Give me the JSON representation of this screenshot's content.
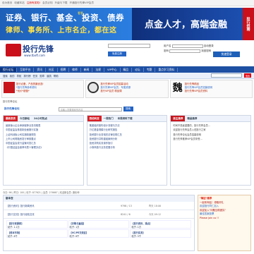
{
  "topbar": {
    "items": [
      "设为首页",
      "收藏本站",
      "注册有奖啦!",
      "会员必知",
      "升级与下载",
      "开通投行先锋VIP会员"
    ]
  },
  "banner": {
    "line1": "证券、银行、基金、投资、债券",
    "line2": "律师、事务所、上市名企，都在这",
    "tagline": "看看",
    "right": "点金人才，高端金融",
    "side": "投行招聘"
  },
  "logo": {
    "name": "投行先锋",
    "url": "www.tbxft.com"
  },
  "header": {
    "search_placeholder": "",
    "register": "免费注册",
    "username_label": "用户名",
    "password_label": "密码",
    "remember": "自动登录",
    "forgot": "找回密码",
    "login_button": "快速登录",
    "login_title": "快速登录"
  },
  "nav": {
    "items": [
      "投行论坛",
      "互助平台",
      "资讯",
      "社区",
      "招聘",
      "律师",
      "新闻",
      "法规",
      "VIP中心",
      "精品",
      "论坛",
      "专题",
      "重点学习资料"
    ]
  },
  "subnav": {
    "items": [
      "搜索",
      "我的",
      "导航",
      "排行榜",
      "任务",
      "勋章",
      "道具",
      "帮助",
      "认证",
      "分享",
      "推荐",
      "收藏"
    ],
    "search_btn": "搜索"
  },
  "ads": [
    {
      "l1": "投行必备，产品的最优选!",
      "l2": "*投行先锋参考资料",
      "l3": "*优价*超值*"
    },
    {
      "l1": "投行先锋VIP会员招募活动",
      "l2": "投行先锋VIP会员，专属资源",
      "l3": "投行VIP会员 精品课"
    },
    {
      "l1": "投行先锋精品",
      "l2": "投行先锋VIP会员招募说明",
      "l3": "投行先锋VIP会员资料"
    }
  ],
  "crumb": "投行先锋论坛",
  "midbar": {
    "brand": "投行先锋论坛",
    "search_placeholder": "请输入您要搜索的内容",
    "search_btn": "搜索"
  },
  "panels": [
    {
      "tabs": [
        "最新发表",
        "今日新帖",
        "24小时热点"
      ],
      "items": [
        "最新版以企业承销保荐业务流程表",
        "中国证监会核准制全面推行实施",
        "上证科创板公司实施制度规范",
        "上市公司再融资发行审核要点",
        "中国证监会发行监管问答汇总",
        "《中国证监会保荐代表人管理办法》"
      ]
    },
    {
      "tabs": [
        "西伯利亚",
        "一周热门",
        "本周资料下载"
      ],
      "items": [
        "集团组织架构设计流程与方法",
        "万亿基金规模行业研究报告",
        "投资银行业务相关法律法规汇总",
        "投资银行并购重组案例分析",
        "投资并购实务操作指引",
        "小券商投行业务发展分析"
      ]
    },
    {
      "tabs": [
        "版主推荐",
        "精品推荐"
      ],
      "items": [
        "时间不是最重要的，投行先锋会员...",
        "欢迎投行先锋会员入驻投行之家",
        "投行先锋论坛会员招募说明",
        "投行先锋推荐VIP会员享受..."
      ]
    }
  ],
  "stats": {
    "today": "今日: 96",
    "yesterday": "昨日: 100",
    "posts": "帖子: 877621",
    "members": "会员: 276667",
    "newest": "欢迎新会员: 唐化坤"
  },
  "forum": {
    "title": "版本去",
    "sections": [
      {
        "name": "【投行资讯】投行新闻资讯",
        "count": "9798 / 13",
        "last": "昨天 18:06"
      },
      {
        "name": "【投行交流】投行经验交流",
        "count": "8241 / 6",
        "last": "今天 09:12"
      }
    ],
    "cells": [
      {
        "title": "【投行资源库】",
        "posts": "帖子: 1.1万"
      },
      {
        "title": "【并购与重组】",
        "posts": "帖子: 1万"
      },
      {
        "title": "【投行资讯、观点】",
        "posts": "帖子: 1万"
      },
      {
        "title": "【资本市场】",
        "posts": "帖子: 8千"
      },
      {
        "title": "【VC/PE交流区】",
        "posts": "帖子: 6千"
      },
      {
        "title": "【投行实务】",
        "posts": "帖子: 5千"
      }
    ]
  },
  "side": {
    "title": "\"掏钻\"推荐",
    "l1": "一起来淘钻！领取好礼",
    "l2": "欢迎投行同仁加入",
    "l3": "欢迎加入\"问题互助团队\"",
    "l4": "最佳答案投票",
    "l5": "Please join us !!"
  }
}
